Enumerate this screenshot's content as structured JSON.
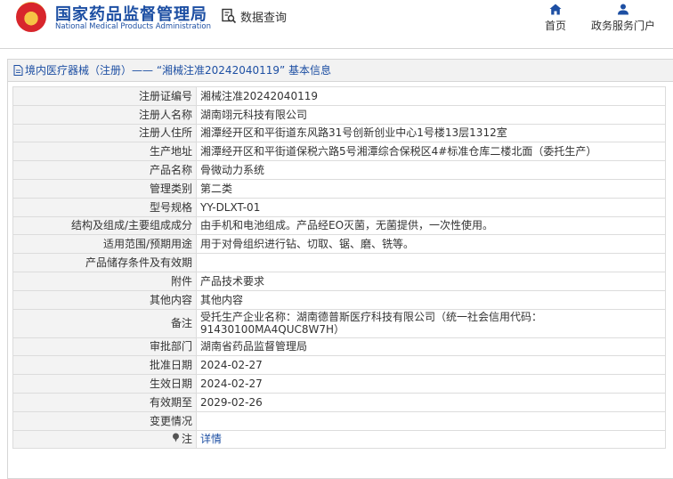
{
  "header": {
    "logo_cn": "国家药品监督管理局",
    "logo_en": "National Medical Products Administration",
    "query_label": "数据查询",
    "nav": [
      {
        "label": "首页",
        "icon": "home-icon"
      },
      {
        "label": "政务服务门户",
        "icon": "user-icon"
      }
    ]
  },
  "breadcrumb": "境内医疗器械（注册）—— “湘械注准20242040119” 基本信息",
  "rows": [
    {
      "label": "注册证编号",
      "value": "湘械注准20242040119"
    },
    {
      "label": "注册人名称",
      "value": "湖南翊元科技有限公司"
    },
    {
      "label": "注册人住所",
      "value": "湘潭经开区和平街道东风路31号创新创业中心1号楼13层1312室"
    },
    {
      "label": "生产地址",
      "value": "湘潭经开区和平街道保税六路5号湘潭综合保税区4#标准仓库二楼北面（委托生产）"
    },
    {
      "label": "产品名称",
      "value": "骨微动力系统"
    },
    {
      "label": "管理类别",
      "value": "第二类"
    },
    {
      "label": "型号规格",
      "value": "YY-DLXT-01"
    },
    {
      "label": "结构及组成/主要组成成分",
      "value": "由手机和电池组成。产品经EO灭菌，无菌提供，一次性使用。"
    },
    {
      "label": "适用范围/预期用途",
      "value": "用于对骨组织进行钻、切取、锯、磨、铣等。"
    },
    {
      "label": "产品储存条件及有效期",
      "value": ""
    },
    {
      "label": "附件",
      "value": "产品技术要求"
    },
    {
      "label": "其他内容",
      "value": "其他内容"
    },
    {
      "label": "备注",
      "value": "受托生产企业名称：湖南德普斯医疗科技有限公司（统一社会信用代码：91430100MA4QUC8W7H）"
    },
    {
      "label": "审批部门",
      "value": "湖南省药品监督管理局"
    },
    {
      "label": "批准日期",
      "value": "2024-02-27"
    },
    {
      "label": "生效日期",
      "value": "2024-02-27"
    },
    {
      "label": "有效期至",
      "value": "2029-02-26"
    },
    {
      "label": "变更情况",
      "value": ""
    }
  ],
  "note_row": {
    "label": "注",
    "value": "详情",
    "icon": "pin-icon"
  },
  "colors": {
    "brand": "#1d4fa3",
    "label_bg": "#f3f3f3",
    "border": "#dcdcdc"
  }
}
